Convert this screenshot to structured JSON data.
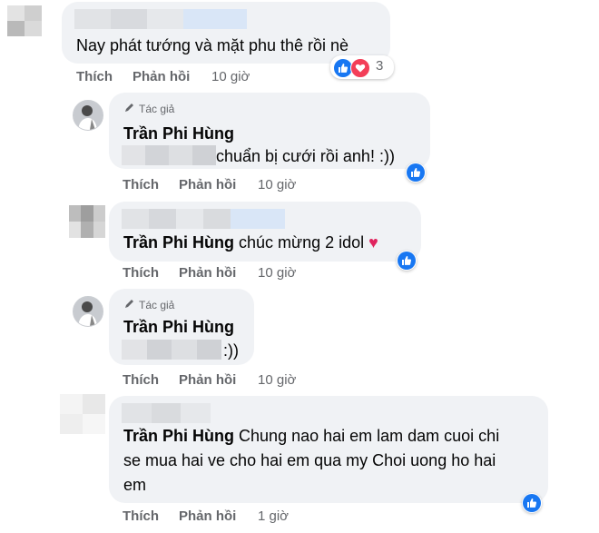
{
  "labels": {
    "like": "Thích",
    "reply": "Phản hồi"
  },
  "author_tag": "Tác giả",
  "comments": [
    {
      "text": "Nay phát tướng và mặt phu thê rồi nè",
      "time": "10 giờ",
      "reaction_count": "3",
      "reactions": [
        "like-icon",
        "love-icon"
      ]
    },
    {
      "name": "Trần Phi Hùng",
      "text": "chuẩn bị cưới rồi anh! :))",
      "time": "10 giờ",
      "reactions": [
        "like-icon"
      ]
    },
    {
      "name": "Trần Phi Hùng",
      "text": "chúc mừng 2 idol",
      "emoji": "♥",
      "time": "10 giờ",
      "reactions": [
        "like-icon"
      ]
    },
    {
      "name": "Trần Phi Hùng",
      "text": ":))",
      "time": "10 giờ"
    },
    {
      "name": "Trần Phi Hùng",
      "text_line1": "Chung nao hai em lam dam cuoi chi",
      "text_line2": "se mua hai ve cho hai em qua my Choi uong ho hai",
      "text_line3": "em",
      "time": "1 giờ",
      "reactions": [
        "like-icon"
      ]
    }
  ],
  "colors": {
    "like": "#1877f2",
    "love": "#f33e58",
    "bubble": "#f0f2f5",
    "meta": "#65676b",
    "heart_emoji": "#e0245e"
  }
}
